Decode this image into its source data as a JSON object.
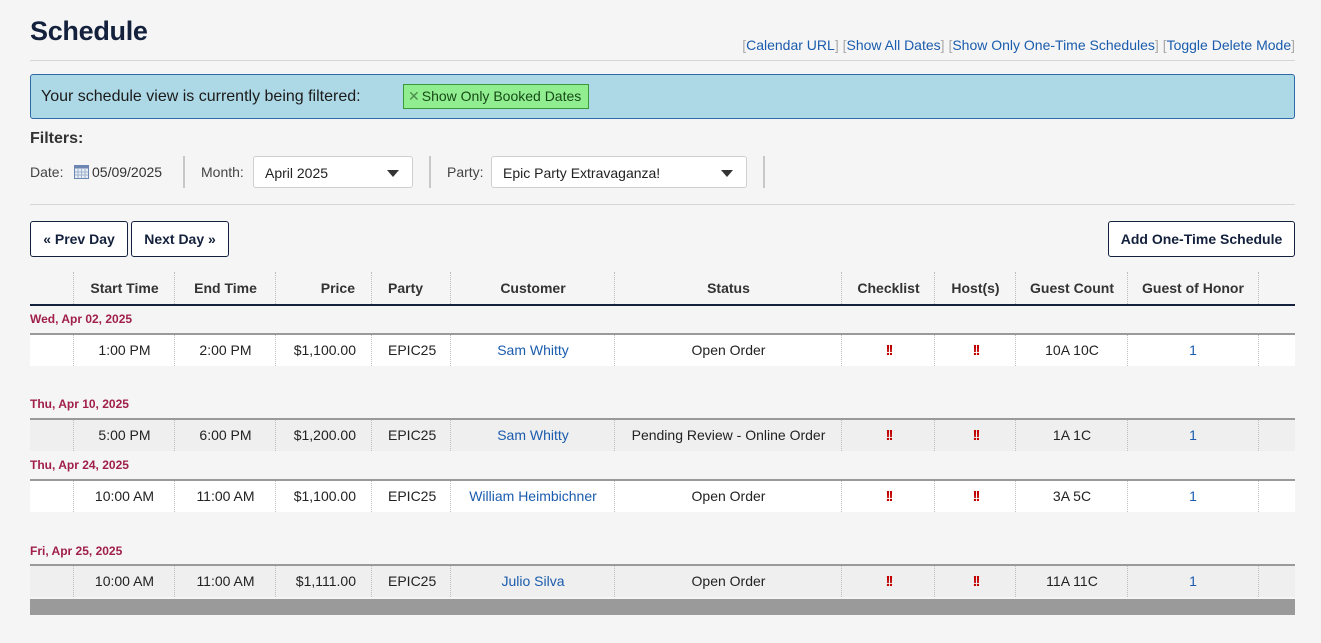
{
  "header": {
    "title": "Schedule",
    "links": [
      "Calendar URL",
      "Show All Dates",
      "Show Only One-Time Schedules",
      "Toggle Delete Mode"
    ]
  },
  "banner": {
    "text": "Your schedule view is currently being filtered:",
    "chip_label": "Show Only Booked Dates"
  },
  "filters": {
    "heading": "Filters:",
    "date_label": "Date:",
    "date_value": "05/09/2025",
    "month_label": "Month:",
    "month_value": "April 2025",
    "party_label": "Party:",
    "party_value": "Epic Party Extravaganza!"
  },
  "buttons": {
    "prev": "« Prev Day",
    "next": "Next Day »",
    "add": "Add One-Time Schedule"
  },
  "table": {
    "columns": [
      "Start Time",
      "End Time",
      "Price",
      "Party",
      "Customer",
      "Status",
      "Checklist",
      "Host(s)",
      "Guest Count",
      "Guest of Honor"
    ],
    "groups": [
      {
        "date": "Wed, Apr 02, 2025",
        "row": {
          "start": "1:00 PM",
          "end": "2:00 PM",
          "price": "$1,100.00",
          "party": "EPIC25",
          "customer": "Sam Whitty",
          "status": "Open Order",
          "checklist": "!!",
          "hosts": "!!",
          "guest_count": "10A 10C",
          "guest_of_honor": "1"
        }
      },
      {
        "date": "Thu, Apr 10, 2025",
        "row": {
          "start": "5:00 PM",
          "end": "6:00 PM",
          "price": "$1,200.00",
          "party": "EPIC25",
          "customer": "Sam Whitty",
          "status": "Pending Review - Online Order",
          "checklist": "!!",
          "hosts": "!!",
          "guest_count": "1A 1C",
          "guest_of_honor": "1"
        }
      },
      {
        "date": "Thu, Apr 24, 2025",
        "row": {
          "start": "10:00 AM",
          "end": "11:00 AM",
          "price": "$1,100.00",
          "party": "EPIC25",
          "customer": "William Heimbichner",
          "status": "Open Order",
          "checklist": "!!",
          "hosts": "!!",
          "guest_count": "3A 5C",
          "guest_of_honor": "1"
        }
      },
      {
        "date": "Fri, Apr 25, 2025",
        "row": {
          "start": "10:00 AM",
          "end": "11:00 AM",
          "price": "$1,111.00",
          "party": "EPIC25",
          "customer": "Julio Silva",
          "status": "Open Order",
          "checklist": "!!",
          "hosts": "!!",
          "guest_count": "11A 11C",
          "guest_of_honor": "1"
        }
      }
    ]
  },
  "colors": {
    "title": "#14213d",
    "link": "#1a5cad",
    "banner_bg": "#add8e6",
    "chip_bg": "#90ee90",
    "date_label": "#a0204a",
    "warn": "#c00000"
  },
  "icons": {
    "date": "calendar-icon",
    "select": "chevron-down-icon",
    "chip": "close-icon",
    "warning": "double-exclamation-icon"
  }
}
